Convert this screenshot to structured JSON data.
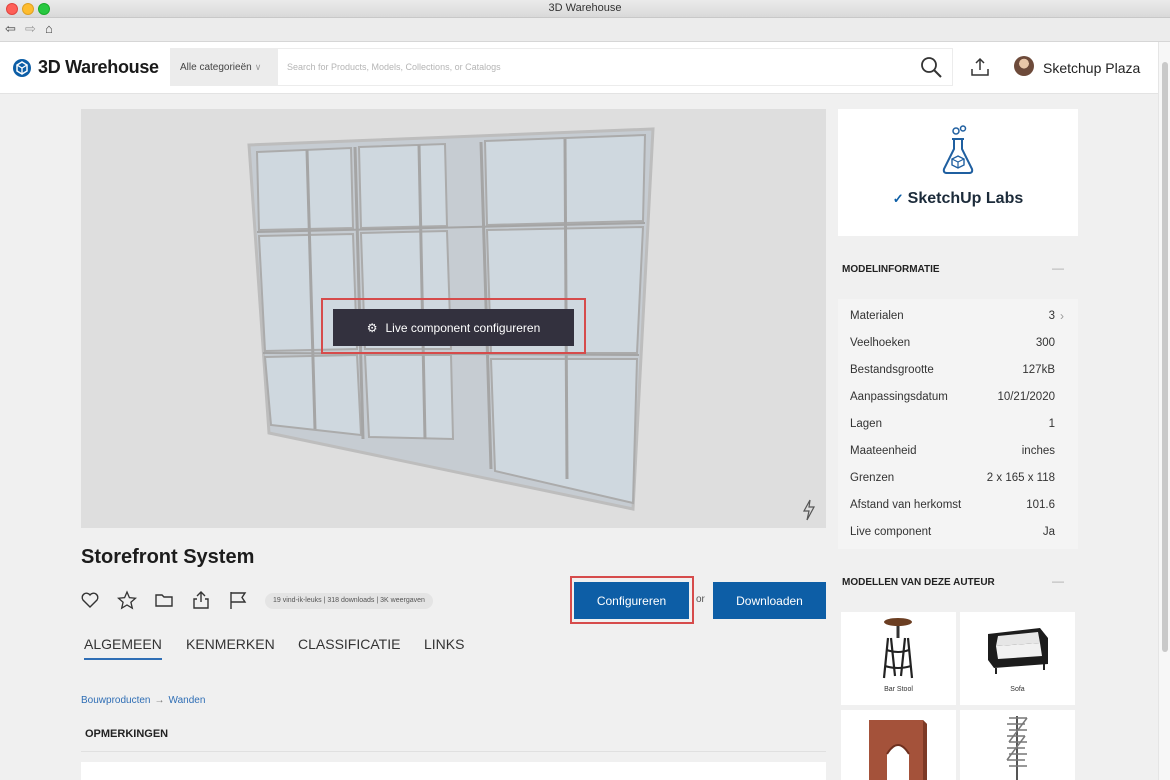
{
  "window": {
    "title": "3D Warehouse"
  },
  "header": {
    "logo_text": "3D Warehouse",
    "category": "Alle categorieën",
    "search_placeholder": "Search for Products, Models, Collections, or Catalogs",
    "user_name": "Sketchup Plaza"
  },
  "viewer": {
    "configure_live_label": "Live component configureren"
  },
  "product": {
    "title": "Storefront System",
    "stats": "19 vind-ik-leuks | 318 downloads | 3K weergaven",
    "configure_label": "Configureren",
    "or_label": "or",
    "download_label": "Downloaden"
  },
  "tabs": [
    {
      "label": "ALGEMEEN",
      "active": true
    },
    {
      "label": "KENMERKEN",
      "active": false
    },
    {
      "label": "CLASSIFICATIE",
      "active": false
    },
    {
      "label": "LINKS",
      "active": false
    }
  ],
  "breadcrumb": {
    "parent": "Bouwproducten",
    "arrow": "→",
    "current": "Wanden"
  },
  "remarks": {
    "heading": "OPMERKINGEN"
  },
  "sidebar": {
    "labs_label": "SketchUp Labs",
    "model_info_heading": "MODELINFORMATIE",
    "collapse_symbol": "—",
    "model_info": [
      {
        "label": "Materialen",
        "value": "3"
      },
      {
        "label": "Veelhoeken",
        "value": "300"
      },
      {
        "label": "Bestandsgrootte",
        "value": "127kB"
      },
      {
        "label": "Aanpassingsdatum",
        "value": "10/21/2020"
      },
      {
        "label": "Lagen",
        "value": "1"
      },
      {
        "label": "Maateenheid",
        "value": "inches"
      },
      {
        "label": "Grenzen",
        "value": "2 x 165 x 118"
      },
      {
        "label": "Afstand van herkomst",
        "value": "101.6"
      },
      {
        "label": "Live component",
        "value": "Ja"
      }
    ],
    "author_models_heading": "MODELLEN VAN DEZE AUTEUR",
    "author_models": [
      {
        "name": "Bar Stool",
        "icon": "bar-stool-thumbnail"
      },
      {
        "name": "Sofa",
        "icon": "sofa-thumbnail"
      },
      {
        "name": "",
        "icon": "brick-arch-thumbnail"
      },
      {
        "name": "",
        "icon": "spiral-stair-thumbnail"
      }
    ]
  },
  "colors": {
    "primary": "#0d5ea6",
    "highlight": "#d64b4b",
    "dark_button": "#33313e"
  }
}
